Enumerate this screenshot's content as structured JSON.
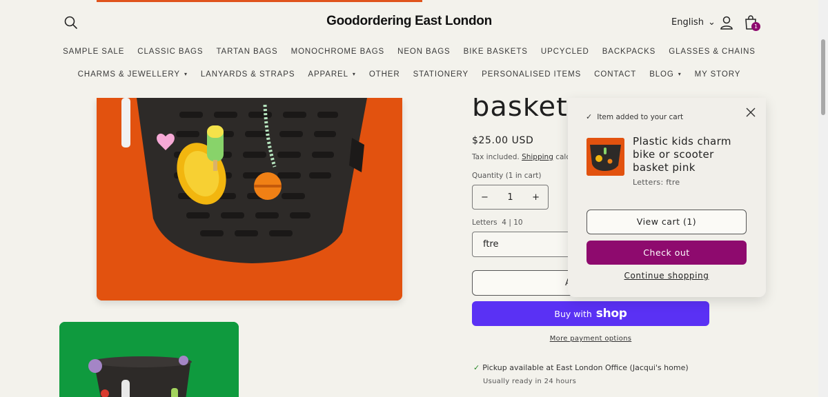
{
  "header": {
    "brand": "Goodordering East London",
    "language": "English",
    "cart_count": "1",
    "accent_color": "#8e0a6e"
  },
  "nav": {
    "row1": [
      "SAMPLE SALE",
      "CLASSIC BAGS",
      "TARTAN BAGS",
      "MONOCHROME BAGS",
      "NEON BAGS",
      "BIKE BASKETS",
      "UPCYCLED",
      "BACKPACKS",
      "GLASSES & CHAINS"
    ],
    "row2": [
      {
        "label": "CHARMS & JEWELLERY",
        "dropdown": true
      },
      {
        "label": "LANYARDS & STRAPS",
        "dropdown": false
      },
      {
        "label": "APPAREL",
        "dropdown": true
      },
      {
        "label": "OTHER",
        "dropdown": false
      },
      {
        "label": "STATIONERY",
        "dropdown": false
      },
      {
        "label": "PERSONALISED ITEMS",
        "dropdown": false
      },
      {
        "label": "CONTACT",
        "dropdown": false
      },
      {
        "label": "BLOG",
        "dropdown": true
      },
      {
        "label": "MY STORY",
        "dropdown": false
      }
    ]
  },
  "product": {
    "title_fragment": "basket",
    "price": "$25.00 USD",
    "tax_prefix": "Tax included.",
    "tax_link": "Shipping",
    "tax_suffix": "calc",
    "quantity_label": "Quantity (1 in cart)",
    "quantity_value": "1",
    "minus": "−",
    "plus": "+",
    "letters_label": "Letters",
    "letters_count": "4 | 10",
    "letters_value": "ftre",
    "add_to_cart_fragment": "A",
    "buy_with": "Buy with",
    "shop": "shop",
    "more_payment": "More payment options",
    "pickup_prefix": "Pickup available at",
    "pickup_location": "East London Office (Jacqui's home)",
    "ready": "Usually ready in 24 hours"
  },
  "cart_popup": {
    "added_text": "Item added to your cart",
    "item_name": "Plastic kids charm bike or scooter basket pink",
    "item_option": "Letters: ftre",
    "view_cart": "View cart (1)",
    "checkout": "Check out",
    "continue": "Continue shopping"
  },
  "icons": {
    "search": "search-icon",
    "account": "account-icon",
    "cart": "cart-icon",
    "close": "close-icon",
    "check": "check-icon"
  }
}
